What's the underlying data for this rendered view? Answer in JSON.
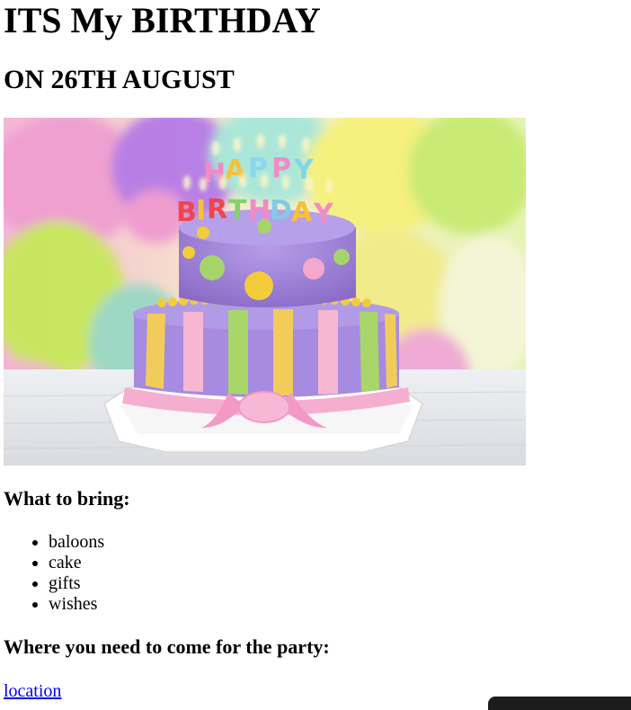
{
  "header": {
    "title": "ITS My BIRTHDAY",
    "subtitle": "ON 26TH AUGUST"
  },
  "hero_image": {
    "alt_semantic": "birthday-cake-photo",
    "cake_topper_text": "HAPPY BIRTHDAY"
  },
  "bring_section": {
    "heading": "What to bring:",
    "items": [
      {
        "label": "baloons"
      },
      {
        "label": "cake"
      },
      {
        "label": "gifts"
      },
      {
        "label": "wishes"
      }
    ]
  },
  "location_section": {
    "heading": "Where you need to come for the party:",
    "link_label": "location"
  },
  "colors": {
    "link": "#0000ee",
    "text": "#000000",
    "corner_bar": "#1c1c1c"
  }
}
